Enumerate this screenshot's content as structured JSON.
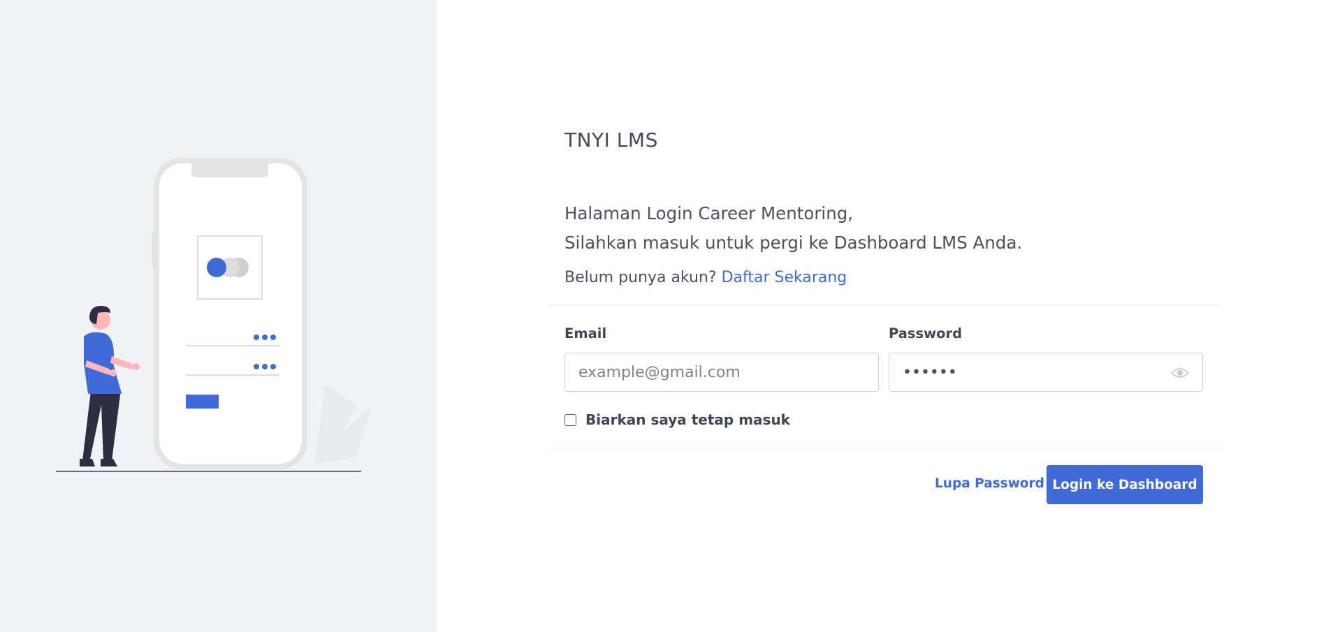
{
  "brand": {
    "title": "TNYI LMS"
  },
  "intro": {
    "line1": "Halaman Login Career Mentoring,",
    "line2": "Silahkan masuk untuk pergi ke Dashboard LMS Anda."
  },
  "signup": {
    "prompt": "Belum punya akun?",
    "link_label": "Daftar Sekarang"
  },
  "form": {
    "email": {
      "label": "Email",
      "value": "",
      "placeholder": "example@gmail.com"
    },
    "password": {
      "label": "Password",
      "value": "••••••",
      "placeholder": "",
      "toggle_icon": "eye-icon"
    },
    "remember": {
      "label": "Biarkan saya tetap masuk",
      "checked": false
    }
  },
  "actions": {
    "forgot_label": "Lupa Password",
    "login_label": "Login ke Dashboard"
  },
  "colors": {
    "primary": "#3f6ad8",
    "left_panel_bg": "#f0f3f6",
    "text": "#434a57"
  }
}
